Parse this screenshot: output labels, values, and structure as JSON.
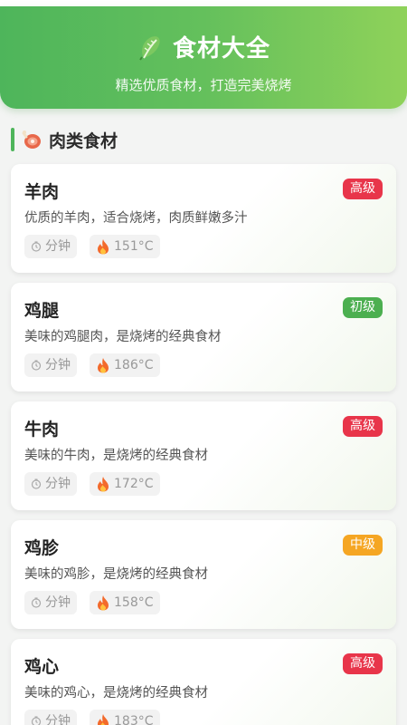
{
  "header": {
    "title": "食材大全",
    "subtitle": "精选优质食材，打造完美烧烤",
    "icon": "leaf-icon"
  },
  "section": {
    "title": "肉类食材",
    "icon": "meat-icon"
  },
  "items": [
    {
      "name": "羊肉",
      "badge": "高级",
      "badge_color": "#e8354a",
      "desc": "优质的羊肉，适合烧烤，肉质鲜嫩多汁",
      "time_label": "分钟",
      "temp": "151°C"
    },
    {
      "name": "鸡腿",
      "badge": "初级",
      "badge_color": "#4caf50",
      "desc": "美味的鸡腿肉，是烧烤的经典食材",
      "time_label": "分钟",
      "temp": "186°C"
    },
    {
      "name": "牛肉",
      "badge": "高级",
      "badge_color": "#e8354a",
      "desc": "美味的牛肉，是烧烤的经典食材",
      "time_label": "分钟",
      "temp": "172°C"
    },
    {
      "name": "鸡胗",
      "badge": "中级",
      "badge_color": "#f5a623",
      "desc": "美味的鸡胗，是烧烤的经典食材",
      "time_label": "分钟",
      "temp": "158°C"
    },
    {
      "name": "鸡心",
      "badge": "高级",
      "badge_color": "#e8354a",
      "desc": "美味的鸡心，是烧烤的经典食材",
      "time_label": "分钟",
      "temp": "183°C"
    }
  ]
}
